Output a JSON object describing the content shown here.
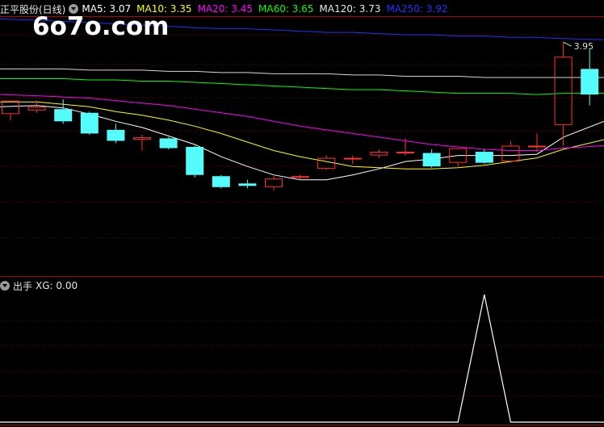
{
  "watermark": "6o7o.com",
  "main_header": {
    "title": "正平股份(日线)",
    "items": [
      {
        "label": "MA5: 3.07",
        "color": "#ffffff"
      },
      {
        "label": "MA10: 3.35",
        "color": "#ffff00"
      },
      {
        "label": "MA20: 3.45",
        "color": "#ff00ff"
      },
      {
        "label": "MA60: 3.65",
        "color": "#00ff00"
      },
      {
        "label": "MA120: 3.73",
        "color": "#e8e8e8"
      },
      {
        "label": "MA250: 3.92",
        "color": "#2233ff"
      }
    ]
  },
  "sub_header": {
    "title": "出手",
    "items": [
      {
        "label": "XG: 0.00",
        "color": "#e6e6e6"
      }
    ]
  },
  "colors": {
    "up": "#ff3333",
    "down": "#54fcfc",
    "grid": "#8b0000",
    "divider": "#b00000",
    "bg": "#000000"
  },
  "chart_data": [
    {
      "type": "candlestick",
      "ylim": [
        2.05,
        4.15
      ],
      "high_label": "3.95",
      "candles": [
        {
          "o": 3.36,
          "h": 3.47,
          "l": 3.31,
          "c": 3.47
        },
        {
          "o": 3.39,
          "h": 3.47,
          "l": 3.37,
          "c": 3.42
        },
        {
          "o": 3.4,
          "h": 3.48,
          "l": 3.28,
          "c": 3.3
        },
        {
          "o": 3.37,
          "h": 3.38,
          "l": 3.19,
          "c": 3.2
        },
        {
          "o": 3.23,
          "h": 3.28,
          "l": 3.12,
          "c": 3.14
        },
        {
          "o": 3.15,
          "h": 3.19,
          "l": 3.06,
          "c": 3.17
        },
        {
          "o": 3.16,
          "h": 3.17,
          "l": 3.07,
          "c": 3.08
        },
        {
          "o": 3.09,
          "h": 3.1,
          "l": 2.84,
          "c": 2.86
        },
        {
          "o": 2.85,
          "h": 2.86,
          "l": 2.75,
          "c": 2.76
        },
        {
          "o": 2.79,
          "h": 2.82,
          "l": 2.75,
          "c": 2.77
        },
        {
          "o": 2.76,
          "h": 2.85,
          "l": 2.73,
          "c": 2.83
        },
        {
          "o": 2.84,
          "h": 2.86,
          "l": 2.82,
          "c": 2.85
        },
        {
          "o": 2.91,
          "h": 3.02,
          "l": 2.9,
          "c": 3.0
        },
        {
          "o": 3.0,
          "h": 3.02,
          "l": 2.95,
          "c": 3.0
        },
        {
          "o": 3.02,
          "h": 3.07,
          "l": 3.0,
          "c": 3.05
        },
        {
          "o": 3.05,
          "h": 3.16,
          "l": 3.02,
          "c": 3.05
        },
        {
          "o": 3.04,
          "h": 3.07,
          "l": 2.92,
          "c": 2.93
        },
        {
          "o": 2.96,
          "h": 3.08,
          "l": 2.93,
          "c": 3.08
        },
        {
          "o": 3.05,
          "h": 3.07,
          "l": 2.95,
          "c": 2.96
        },
        {
          "o": 2.97,
          "h": 3.14,
          "l": 2.96,
          "c": 3.1
        },
        {
          "o": 3.1,
          "h": 3.2,
          "l": 3.05,
          "c": 3.1
        },
        {
          "o": 3.27,
          "h": 3.95,
          "l": 3.1,
          "c": 3.83
        },
        {
          "o": 3.73,
          "h": 3.89,
          "l": 3.43,
          "c": 3.52
        }
      ],
      "ma": [
        {
          "name": "MA5",
          "color": "#ffffff",
          "values": [
            3.42,
            3.43,
            3.41,
            3.36,
            3.3,
            3.25,
            3.18,
            3.11,
            3.01,
            2.93,
            2.86,
            2.82,
            2.82,
            2.86,
            2.91,
            2.97,
            2.99,
            3.02,
            3.02,
            3.02,
            3.03,
            3.17,
            3.3
          ]
        },
        {
          "name": "MA10",
          "color": "#ffff00",
          "values": [
            3.46,
            3.46,
            3.44,
            3.42,
            3.38,
            3.35,
            3.31,
            3.26,
            3.2,
            3.13,
            3.06,
            3.01,
            2.97,
            2.93,
            2.92,
            2.91,
            2.91,
            2.92,
            2.94,
            2.97,
            3.0,
            3.07,
            3.15
          ]
        },
        {
          "name": "MA20",
          "color": "#ff00ff",
          "values": [
            3.52,
            3.51,
            3.5,
            3.49,
            3.47,
            3.45,
            3.43,
            3.4,
            3.37,
            3.34,
            3.3,
            3.26,
            3.23,
            3.2,
            3.17,
            3.14,
            3.11,
            3.09,
            3.07,
            3.06,
            3.06,
            3.08,
            3.1
          ]
        },
        {
          "name": "MA60",
          "color": "#00ff00",
          "values": [
            3.65,
            3.65,
            3.65,
            3.64,
            3.64,
            3.63,
            3.63,
            3.62,
            3.61,
            3.6,
            3.59,
            3.58,
            3.57,
            3.56,
            3.56,
            3.55,
            3.54,
            3.53,
            3.53,
            3.53,
            3.52,
            3.53,
            3.53
          ]
        },
        {
          "name": "MA120",
          "color": "#d8d8d8",
          "values": [
            3.73,
            3.73,
            3.73,
            3.72,
            3.72,
            3.72,
            3.71,
            3.71,
            3.7,
            3.7,
            3.69,
            3.69,
            3.69,
            3.68,
            3.68,
            3.67,
            3.67,
            3.67,
            3.66,
            3.66,
            3.66,
            3.66,
            3.66
          ]
        },
        {
          "name": "MA250",
          "color": "#2233ff",
          "values": [
            4.14,
            4.13,
            4.12,
            4.11,
            4.1,
            4.09,
            4.08,
            4.07,
            4.06,
            4.06,
            4.05,
            4.04,
            4.03,
            4.03,
            4.02,
            4.01,
            4.01,
            4.0,
            4.0,
            3.99,
            3.99,
            3.98,
            3.97
          ]
        }
      ]
    },
    {
      "type": "line",
      "name": "XG",
      "color": "#ffffff",
      "ylim": [
        0,
        1
      ],
      "values": [
        0,
        0,
        0,
        0,
        0,
        0,
        0,
        0,
        0,
        0,
        0,
        0,
        0,
        0,
        0,
        0,
        0,
        0,
        1,
        0,
        0,
        0,
        0
      ]
    }
  ]
}
